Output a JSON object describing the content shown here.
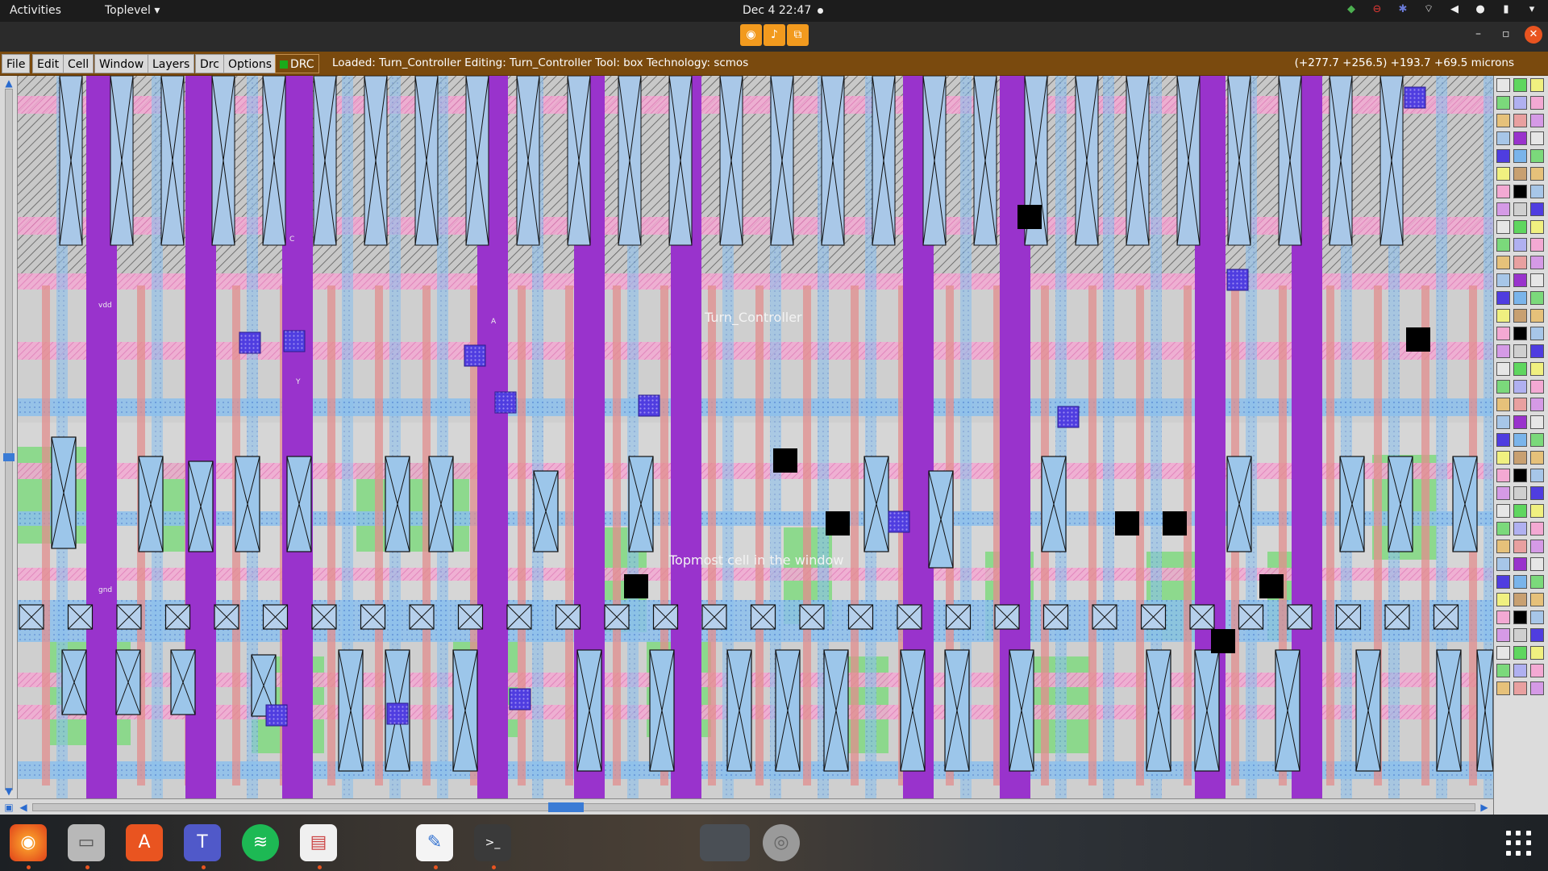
{
  "topbar": {
    "activities": "Activities",
    "app_menu": "Toplevel",
    "clock": "Dec 4  22:47"
  },
  "menu": {
    "file": "File",
    "edit": "Edit",
    "cell": "Cell",
    "window": "Window",
    "layers": "Layers",
    "drc": "Drc",
    "options": "Options",
    "drc_indicator": "DRC"
  },
  "status": {
    "text": "Loaded: Turn_Controller  Editing: Turn_Controller  Tool: box   Technology: scmos",
    "coords": "(+277.7 +256.5) +193.7 +69.5 microns"
  },
  "canvas": {
    "cell_name": "Turn_Controller",
    "hint": "Topmost cell in the window",
    "labels": [
      "vdd",
      "gnd",
      "A",
      "Y",
      "C"
    ]
  },
  "dock": {
    "apps": [
      "firefox-icon",
      "files-icon",
      "software-icon",
      "teams-icon",
      "spotify-icon",
      "viewer-icon",
      "editor-icon",
      "terminal-icon",
      "magic-window-icon",
      "disk-icon"
    ]
  },
  "colors": {
    "metal1": "#7ab4ea",
    "metal2": "#c5a3e6",
    "poly": "#e28d8d",
    "ndiff": "#7bd97b",
    "pdiff": "#c8a071",
    "nwell": "#9933cc",
    "contact": "#000000",
    "menubar": "#7a4a0e"
  }
}
